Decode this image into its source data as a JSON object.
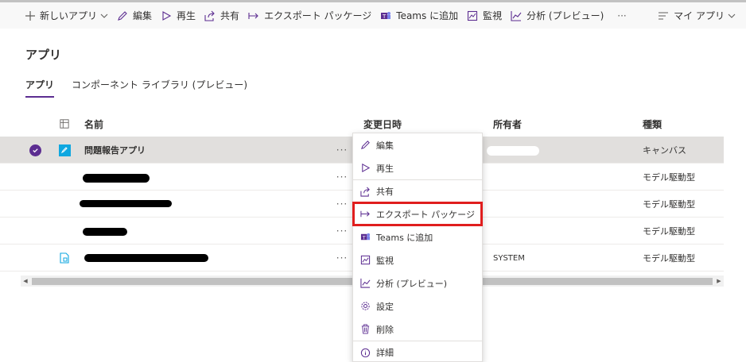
{
  "toolbar": {
    "new_app": "新しいアプリ",
    "edit": "編集",
    "play": "再生",
    "share": "共有",
    "export": "エクスポート パッケージ",
    "teams": "Teams に追加",
    "monitor": "監視",
    "analytics": "分析 (プレビュー)",
    "more": "···",
    "my_apps": "マイ アプリ"
  },
  "page": {
    "title": "アプリ"
  },
  "tabs": [
    {
      "label": "アプリ",
      "active": true
    },
    {
      "label": "コンポーネント ライブラリ (プレビュー)",
      "active": false
    }
  ],
  "table": {
    "headers": {
      "name": "名前",
      "modified": "変更日時",
      "owner": "所有者",
      "type": "種類"
    },
    "rows": [
      {
        "name": "問題報告アプリ",
        "more": "···",
        "owner": "",
        "type": "キャンバス",
        "selected": true,
        "icon": "canvas-app-icon"
      },
      {
        "name": "",
        "more": "···",
        "owner": "",
        "type": "モデル駆動型",
        "selected": false,
        "icon": ""
      },
      {
        "name": "",
        "more": "···",
        "owner": "",
        "type": "モデル駆動型",
        "selected": false,
        "icon": ""
      },
      {
        "name": "",
        "more": "···",
        "owner": "",
        "type": "モデル駆動型",
        "selected": false,
        "icon": ""
      },
      {
        "name": "",
        "more": "···",
        "owner": "SYSTEM",
        "type": "モデル駆動型",
        "selected": false,
        "icon": "model-app-icon"
      }
    ]
  },
  "context_menu": {
    "items": [
      {
        "label": "編集",
        "icon": "pencil-icon"
      },
      {
        "label": "再生",
        "icon": "play-icon"
      },
      {
        "label": "共有",
        "icon": "share-icon"
      },
      {
        "label": "エクスポート パッケージ",
        "icon": "export-icon",
        "highlighted": true
      },
      {
        "label": "Teams に追加",
        "icon": "teams-icon"
      },
      {
        "label": "監視",
        "icon": "monitor-icon"
      },
      {
        "label": "分析 (プレビュー)",
        "icon": "analytics-icon"
      },
      {
        "label": "設定",
        "icon": "gear-icon"
      },
      {
        "label": "削除",
        "icon": "trash-icon"
      },
      {
        "label": "詳細",
        "icon": "info-icon"
      }
    ]
  },
  "colors": {
    "accent": "#5c2d91",
    "highlight": "#e01e1e",
    "canvas_icon": "#0fa7e0"
  }
}
